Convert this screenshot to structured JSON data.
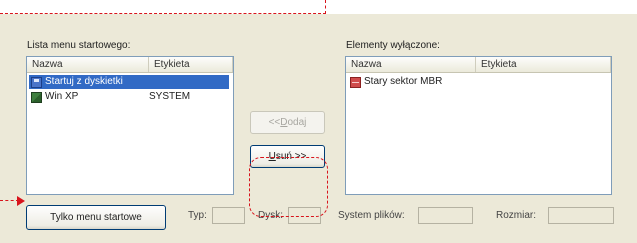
{
  "boot_list": {
    "label": "Lista menu startowego:",
    "columns": [
      "Nazwa",
      "Etykieta"
    ],
    "rows": [
      {
        "name": "Startuj z dyskietki",
        "label": "",
        "icon": "floppy-icon",
        "selected": true
      },
      {
        "name": "Win XP",
        "label": "SYSTEM",
        "icon": "windows-icon",
        "selected": false
      }
    ]
  },
  "excluded_list": {
    "label": "Elementy wyłączone:",
    "columns": [
      "Nazwa",
      "Etykieta"
    ],
    "rows": [
      {
        "name": "Stary sektor MBR",
        "label": "",
        "icon": "mbr-icon"
      }
    ]
  },
  "buttons": {
    "add": {
      "prefix": "<< ",
      "key": "D",
      "suffix": "odaj"
    },
    "remove": {
      "key": "U",
      "suffix": "suń >>"
    },
    "boot_only": "Tylko menu startowe"
  },
  "fields": {
    "type_label": "Typ:",
    "disk_label": "Dysk:",
    "fs_label": "System plików:",
    "size_label": "Rozmiar:"
  },
  "colors": {
    "annotation": "#d8141c",
    "selection": "#316ac5"
  }
}
